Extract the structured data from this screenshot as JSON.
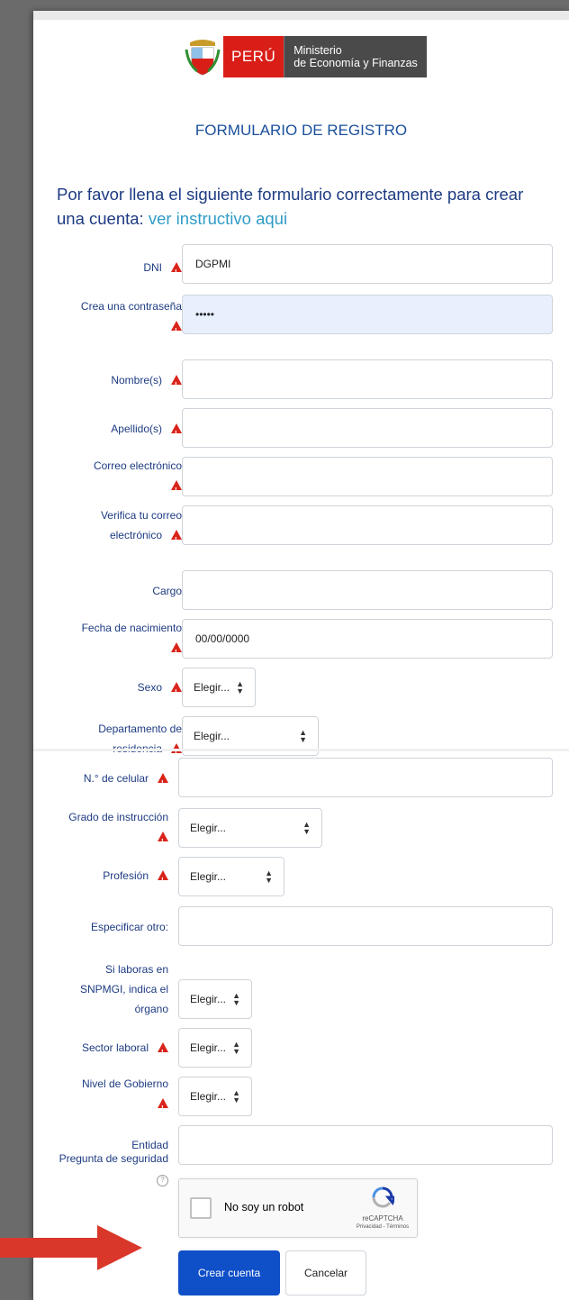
{
  "header": {
    "logo_peru": "PERÚ",
    "logo_ministry_line1": "Ministerio",
    "logo_ministry_line2": "de Economía y Finanzas"
  },
  "form": {
    "title": "FORMULARIO DE REGISTRO",
    "intro": "Por favor llena el siguiente formulario correctamente para crear una cuenta:",
    "intro_link": "ver instructivo aqui",
    "fields": {
      "dni": {
        "label": "DNI",
        "value": "DGPMI"
      },
      "password": {
        "label": "Crea una contraseña",
        "value": "•••••"
      },
      "nombre": {
        "label": "Nombre(s)",
        "value": ""
      },
      "apellido": {
        "label": "Apellido(s)",
        "value": ""
      },
      "correo": {
        "label": "Correo electrónico",
        "value": ""
      },
      "verifica_correo": {
        "label": "Verifica tu correo electrónico",
        "value": ""
      },
      "cargo": {
        "label": "Cargo",
        "value": ""
      },
      "fecha": {
        "label": "Fecha de nacimiento",
        "value": "00/00/0000"
      },
      "sexo": {
        "label": "Sexo",
        "value": "Elegir..."
      },
      "departamento": {
        "label": "Departamento de residencia",
        "value": "Elegir..."
      },
      "celular": {
        "label": "N.° de celular",
        "value": ""
      },
      "grado": {
        "label": "Grado de instrucción",
        "value": "Elegir..."
      },
      "profesion": {
        "label": "Profesión",
        "value": "Elegir..."
      },
      "otro": {
        "label": "Especificar otro:",
        "value": ""
      },
      "snpmgi": {
        "label": "Si laboras en SNPMGI, indica el órgano",
        "value": "Elegir..."
      },
      "sector": {
        "label": "Sector laboral",
        "value": "Elegir..."
      },
      "nivel": {
        "label": "Nivel de Gobierno",
        "value": "Elegir..."
      },
      "entidad": {
        "label": "Entidad",
        "value": ""
      },
      "pregunta": {
        "label": "Pregunta de seguridad"
      }
    },
    "captcha": {
      "text": "No soy un robot",
      "brand": "reCAPTCHA",
      "links": "Privacidad - Términos"
    },
    "buttons": {
      "submit": "Crear cuenta",
      "cancel": "Cancelar"
    }
  },
  "colors": {
    "primary": "#0f4fc8",
    "title": "#1a4f9c",
    "warning": "#d9241b",
    "arrow": "#d9372a",
    "logo_red": "#d91e18"
  }
}
